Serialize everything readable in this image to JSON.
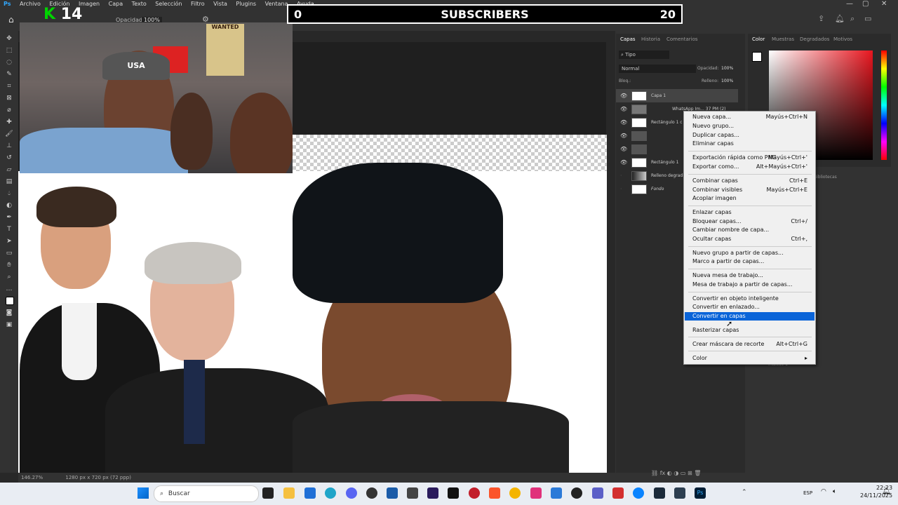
{
  "menu": [
    "Archivo",
    "Edición",
    "Imagen",
    "Capa",
    "Texto",
    "Selección",
    "Filtro",
    "Vista",
    "Plugins",
    "Ventana",
    "Ayuda"
  ],
  "options": {
    "opacity_label": "Opacidad:",
    "opacity_value": "100%"
  },
  "overlay": {
    "logo_k": "K",
    "logo_num": "14",
    "sub_left": "0",
    "sub_center": "SUBSCRIBERS",
    "sub_right": "20",
    "cap_text": "USA",
    "wanted_text": "WANTED"
  },
  "status": {
    "zoom": "146.27%",
    "doc_size": "1280 px x 720 px (72 ppp)"
  },
  "layers_panel": {
    "tabs": [
      "Capas",
      "Historia",
      "Comentarios"
    ],
    "filter": "Tipo",
    "blend_mode": "Normal",
    "opacity_label": "Opacidad:",
    "opacity_value": "100%",
    "lock_label": "Bloq.:",
    "fill_label": "Relleno:",
    "fill_value": "100%",
    "layers": [
      {
        "name": "Capa 1"
      },
      {
        "name": "WhatsApp Im... 37 PM (2)"
      },
      {
        "name": "Rectángulo 1 c"
      },
      {
        "name": ""
      },
      {
        "name": ""
      },
      {
        "name": "Rectángulo 1"
      },
      {
        "name": "Relleno degrad"
      },
      {
        "name": "Fondo"
      }
    ]
  },
  "color_panel": {
    "tabs": [
      "Color",
      "Muestras",
      "Degradados",
      "Motivos"
    ],
    "bibliotecas": "Bibliotecas",
    "trazado": "Trazado 1"
  },
  "context_menu": [
    {
      "label": "Nueva capa...",
      "shortcut": "Mayús+Ctrl+N"
    },
    {
      "label": "Nuevo grupo...",
      "shortcut": ""
    },
    {
      "label": "Duplicar capas...",
      "shortcut": ""
    },
    {
      "label": "Eliminar capas",
      "shortcut": ""
    },
    {
      "label": "Exportación rápida como PNG",
      "shortcut": "Mayús+Ctrl+'"
    },
    {
      "label": "Exportar como...",
      "shortcut": "Alt+Mayús+Ctrl+'"
    },
    {
      "label": "Combinar capas",
      "shortcut": "Ctrl+E"
    },
    {
      "label": "Combinar visibles",
      "shortcut": "Mayús+Ctrl+E"
    },
    {
      "label": "Acoplar imagen",
      "shortcut": ""
    },
    {
      "label": "Enlazar capas",
      "shortcut": ""
    },
    {
      "label": "Bloquear capas...",
      "shortcut": "Ctrl+/"
    },
    {
      "label": "Cambiar nombre de capa...",
      "shortcut": ""
    },
    {
      "label": "Ocultar capas",
      "shortcut": "Ctrl+,"
    },
    {
      "label": "Nuevo grupo a partir de capas...",
      "shortcut": ""
    },
    {
      "label": "Marco a partir de capas...",
      "shortcut": ""
    },
    {
      "label": "Nueva mesa de trabajo...",
      "shortcut": ""
    },
    {
      "label": "Mesa de trabajo a partir de capas...",
      "shortcut": ""
    },
    {
      "label": "Convertir en objeto inteligente",
      "shortcut": ""
    },
    {
      "label": "Convertir en enlazado...",
      "shortcut": ""
    },
    {
      "label": "Convertir en capas",
      "shortcut": ""
    },
    {
      "label": "Rasterizar capas",
      "shortcut": ""
    },
    {
      "label": "Crear máscara de recorte",
      "shortcut": "Alt+Ctrl+G"
    },
    {
      "label": "Color",
      "shortcut": "▸"
    }
  ],
  "taskbar": {
    "search_placeholder": "Buscar",
    "lang": "ESP",
    "time": "22:23",
    "date": "24/11/2025"
  }
}
